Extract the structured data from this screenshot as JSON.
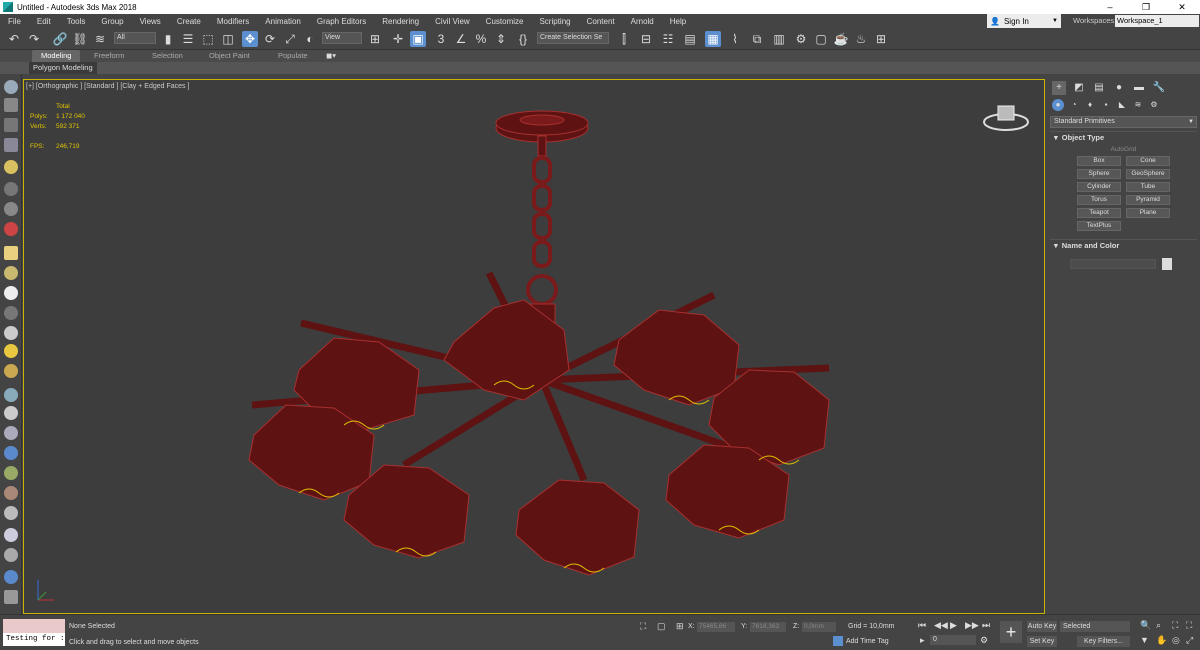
{
  "window": {
    "title": "Untitled - Autodesk 3ds Max 2018",
    "minimize": "–",
    "restore": "❐",
    "close": "✕"
  },
  "menu": [
    "File",
    "Edit",
    "Tools",
    "Group",
    "Views",
    "Create",
    "Modifiers",
    "Animation",
    "Graph Editors",
    "Rendering",
    "Civil View",
    "Customize",
    "Scripting",
    "Content",
    "Arnold",
    "Help"
  ],
  "signin": {
    "label": "Sign In"
  },
  "workspace": {
    "label": "Workspaces:",
    "value": "Workspace_1"
  },
  "toolbar": {
    "filter_value": "All",
    "ref_coord_value": "View",
    "selection_set_placeholder": "Create Selection Se"
  },
  "ribbon": {
    "tabs": [
      "Modeling",
      "Freeform",
      "Selection",
      "Object Paint",
      "Populate"
    ],
    "active": "Modeling",
    "sub": "Polygon Modeling"
  },
  "viewport": {
    "label": "[+] [Orthographic ] [Standard ] [Clay + Edged Faces ]",
    "stats": {
      "total_label": "Total",
      "polys_label": "Polys:",
      "polys": "1 172 040",
      "verts_label": "Verts:",
      "verts": "592 371",
      "fps_label": "FPS:",
      "fps": "246,719"
    },
    "model_color": "#5e1212"
  },
  "command_panel": {
    "dropdown": "Standard Primitives",
    "object_type_header": "Object Type",
    "autogrid": "AutoGrid",
    "buttons": [
      "Box",
      "Cone",
      "Sphere",
      "GeoSphere",
      "Cylinder",
      "Tube",
      "Torus",
      "Pyramid",
      "Teapot",
      "Plane",
      "TextPlus"
    ],
    "name_color_header": "Name and Color"
  },
  "status": {
    "script_text": "Testing for :",
    "selection": "None Selected",
    "prompt": "Click and drag to select and move objects",
    "x_label": "X:",
    "x_value": "75465,86",
    "y_label": "Y:",
    "y_value": "7618,363",
    "z_label": "Z:",
    "z_value": "0,0mm",
    "grid": "Grid = 10,0mm",
    "add_time_tag": "Add Time Tag",
    "frame": "0",
    "auto_key": "Auto Key",
    "set_key": "Set Key",
    "selected": "Selected",
    "key_filters": "Key Filters..."
  }
}
